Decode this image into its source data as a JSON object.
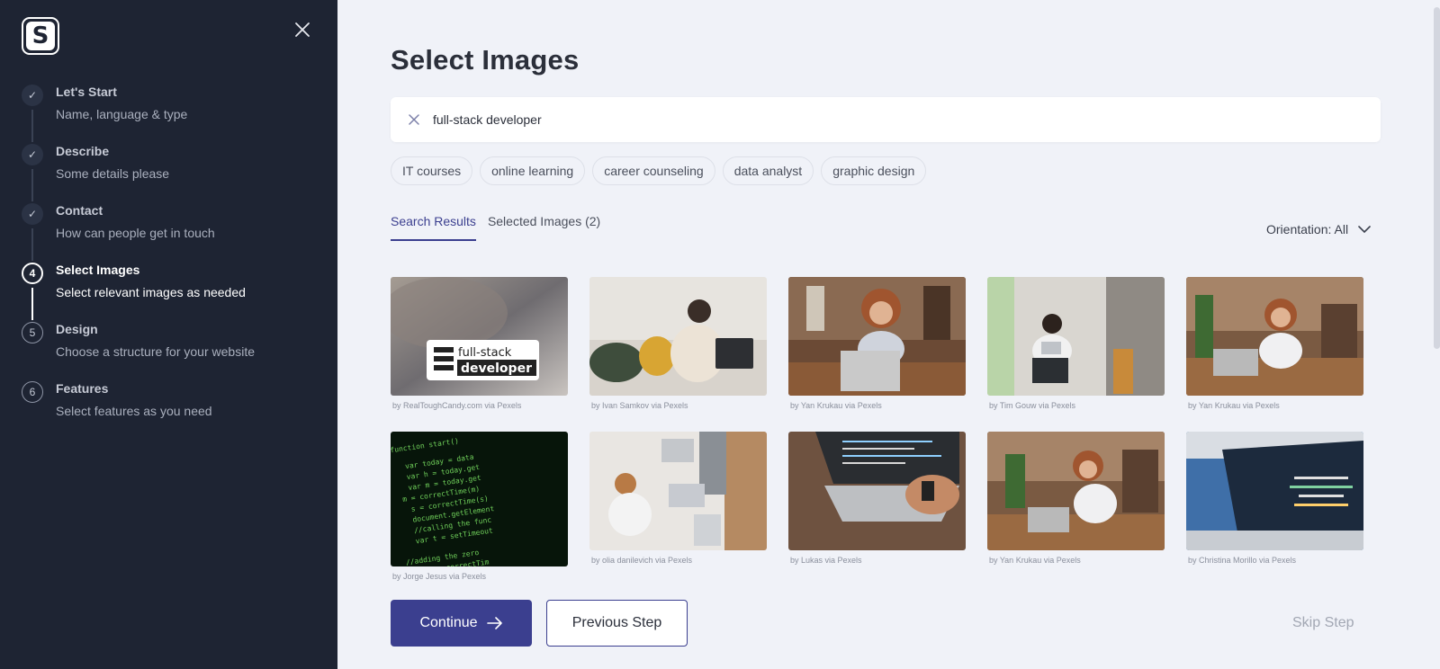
{
  "sidebar": {
    "logo_letter": "S",
    "steps": [
      {
        "marker": "✓",
        "title": "Let's Start",
        "subtitle": "Name, language & type",
        "state": "done"
      },
      {
        "marker": "✓",
        "title": "Describe",
        "subtitle": "Some details please",
        "state": "done"
      },
      {
        "marker": "✓",
        "title": "Contact",
        "subtitle": "How can people get in touch",
        "state": "done"
      },
      {
        "marker": "4",
        "title": "Select Images",
        "subtitle": "Select relevant images as needed",
        "state": "active"
      },
      {
        "marker": "5",
        "title": "Design",
        "subtitle": "Choose a structure for your website",
        "state": "todo"
      },
      {
        "marker": "6",
        "title": "Features",
        "subtitle": "Select features as you need",
        "state": "todo"
      }
    ]
  },
  "main": {
    "title": "Select Images",
    "search": {
      "value": "full-stack developer"
    },
    "chips": [
      "IT courses",
      "online learning",
      "career counseling",
      "data analyst",
      "graphic design"
    ],
    "tabs": [
      "Search Results",
      "Selected Images (2)"
    ],
    "orientation_label": "Orientation: All",
    "images": [
      {
        "credit": "by RealToughCandy.com via Pexels",
        "badge_line1": "full-stack",
        "badge_line2": "developer"
      },
      {
        "credit": "by Ivan Samkov via Pexels"
      },
      {
        "credit": "by Yan Krukau via Pexels"
      },
      {
        "credit": "by Tim Gouw via Pexels"
      },
      {
        "credit": "by Yan Krukau via Pexels"
      },
      {
        "credit": "by Jorge Jesus via Pexels",
        "code_lines": [
          "function start()",
          "var today = data",
          "var h = today.get",
          "var m = today.get",
          "m = correctTime(m)",
          "s = correctTime(s)",
          "document.getElement",
          "//calling the func",
          "var t = setTimeout",
          "//adding the zero",
          "function correctTim"
        ]
      },
      {
        "credit": "by olia danilevich via Pexels"
      },
      {
        "credit": "by Lukas via Pexels"
      },
      {
        "credit": "by Yan Krukau via Pexels"
      },
      {
        "credit": "by Christina Morillo via Pexels"
      }
    ],
    "continue_label": "Continue",
    "previous_label": "Previous Step",
    "skip_label": "Skip Step"
  },
  "colors": {
    "sidebar_bg": "#1e2433",
    "accent": "#3b3f8f",
    "page_bg": "#f0f2f8"
  }
}
